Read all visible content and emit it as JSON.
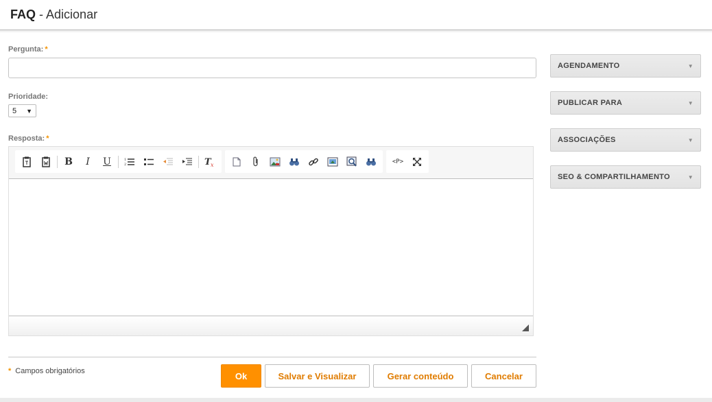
{
  "header": {
    "title_strong": "FAQ",
    "title_sep": " - ",
    "title_rest": "Adicionar"
  },
  "form": {
    "question_label": "Pergunta:",
    "question_value": "",
    "priority_label": "Prioridade:",
    "priority_value": "5",
    "answer_label": "Resposta:",
    "required_marker": "*",
    "required_note": "Campos obrigatórios"
  },
  "toolbar": {
    "groups": [
      [
        "paste-text-icon",
        "paste-word-icon",
        "|",
        "bold-icon",
        "italic-icon",
        "underline-icon",
        "|",
        "numbered-list-icon",
        "bulleted-list-icon",
        "decrease-indent-icon",
        "increase-indent-icon",
        "|",
        "remove-format-icon"
      ],
      [
        "new-page-icon",
        "attachment-icon",
        "image-icon",
        "find-icon",
        "link-icon",
        "insert-media-icon",
        "preview-icon",
        "replace-icon"
      ],
      [
        "source-code-icon",
        "maximize-icon"
      ]
    ]
  },
  "buttons": {
    "ok": "Ok",
    "save_view": "Salvar e Visualizar",
    "generate": "Gerar conteúdo",
    "cancel": "Cancelar"
  },
  "side_panels": [
    "AGENDAMENTO",
    "PUBLICAR PARA",
    "ASSOCIAÇÕES",
    "SEO & COMPARTILHAMENTO"
  ],
  "colors": {
    "accent": "#ff9000",
    "button_text": "#e07c00",
    "required": "#f39200"
  }
}
